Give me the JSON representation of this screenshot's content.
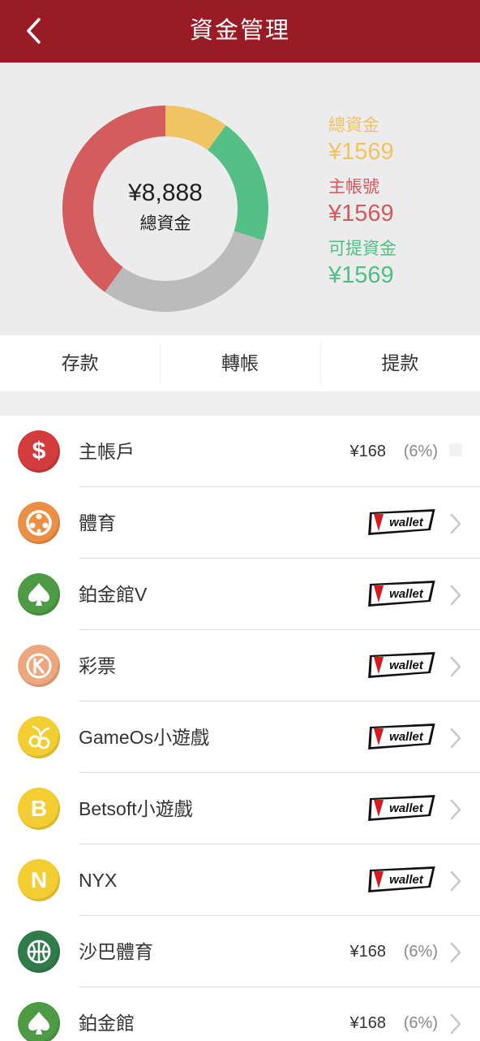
{
  "header": {
    "title": "資金管理"
  },
  "summary": {
    "total_amount": "¥8,888",
    "total_label": "總資金",
    "legend": [
      {
        "label": "總資金",
        "value": "¥1569",
        "color": "#f0c264"
      },
      {
        "label": "主帳號",
        "value": "¥1569",
        "color": "#d6585a"
      },
      {
        "label": "可提資金",
        "value": "¥1569",
        "color": "#4fbf84"
      }
    ],
    "donut_segments": [
      {
        "fraction": 0.1,
        "color": "#efc463"
      },
      {
        "fraction": 0.2,
        "color": "#54c085"
      },
      {
        "fraction": 0.3,
        "color": "#bbbbbb"
      },
      {
        "fraction": 0.4,
        "color": "#d45c5c"
      }
    ]
  },
  "actions": [
    "存款",
    "轉帳",
    "提款"
  ],
  "accounts": [
    {
      "name": "主帳戶",
      "icon": "dollar-icon",
      "color": "#d23c3c",
      "amount": "¥168",
      "percent": "(6%)",
      "vwallet": false
    },
    {
      "name": "體育",
      "icon": "soccer-ball-icon",
      "color": "#eb8f45",
      "amount": "",
      "percent": "",
      "vwallet": true
    },
    {
      "name": "鉑金館V",
      "icon": "spade-icon",
      "color": "#4e9b45",
      "amount": "",
      "percent": "",
      "vwallet": true
    },
    {
      "name": "彩票",
      "icon": "lottery-k-icon",
      "color": "#eca77c",
      "amount": "",
      "percent": "",
      "vwallet": true
    },
    {
      "name": "GameOs小遊戲",
      "icon": "cherry-icon",
      "color": "#f3ce32",
      "amount": "",
      "percent": "",
      "vwallet": true
    },
    {
      "name": "Betsoft小遊戲",
      "icon": "letter-b-icon",
      "color": "#f3ce32",
      "amount": "",
      "percent": "",
      "vwallet": true
    },
    {
      "name": "NYX",
      "icon": "letter-n-icon",
      "color": "#f3ce32",
      "amount": "",
      "percent": "",
      "vwallet": true
    },
    {
      "name": "沙巴體育",
      "icon": "basketball-icon",
      "color": "#2f7b49",
      "amount": "¥168",
      "percent": "(6%)",
      "vwallet": false
    },
    {
      "name": "鉑金館",
      "icon": "spade-icon",
      "color": "#4e9b45",
      "amount": "¥168",
      "percent": "(6%)",
      "vwallet": false
    }
  ],
  "vwallet_text": "Vwallet"
}
